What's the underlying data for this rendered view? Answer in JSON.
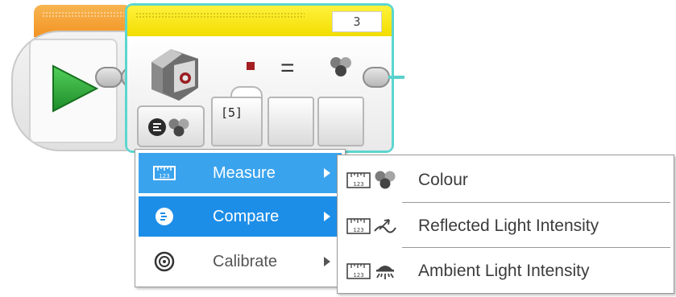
{
  "program": {
    "start_block": {
      "icon": "play-icon"
    },
    "sensor_block": {
      "port": "3",
      "icon": "colour-sensor-icon",
      "comparison_icon": "stop-square-icon",
      "operator": "=",
      "mode_icon": "colour-dots-icon",
      "param_value": "[5]"
    }
  },
  "mode_menu": {
    "items": [
      {
        "label": "Measure",
        "icon": "ruler-icon",
        "state": "highlighted"
      },
      {
        "label": "Compare",
        "icon": "compare-icon",
        "state": "selected"
      },
      {
        "label": "Calibrate",
        "icon": "target-icon",
        "state": "normal"
      }
    ]
  },
  "submenu": {
    "items": [
      {
        "label": "Colour",
        "icon": "colour-dots-icon"
      },
      {
        "label": "Reflected Light Intensity",
        "icon": "reflected-light-icon"
      },
      {
        "label": "Ambient Light Intensity",
        "icon": "ambient-light-icon"
      }
    ]
  },
  "colors": {
    "wire": "#59d1cb",
    "sensor_header": "#f2dd00",
    "start_header": "#f39323",
    "menu_highlight": "#3aa3ed",
    "menu_selected": "#1d8ee8",
    "play_green": "#2eab3a"
  }
}
